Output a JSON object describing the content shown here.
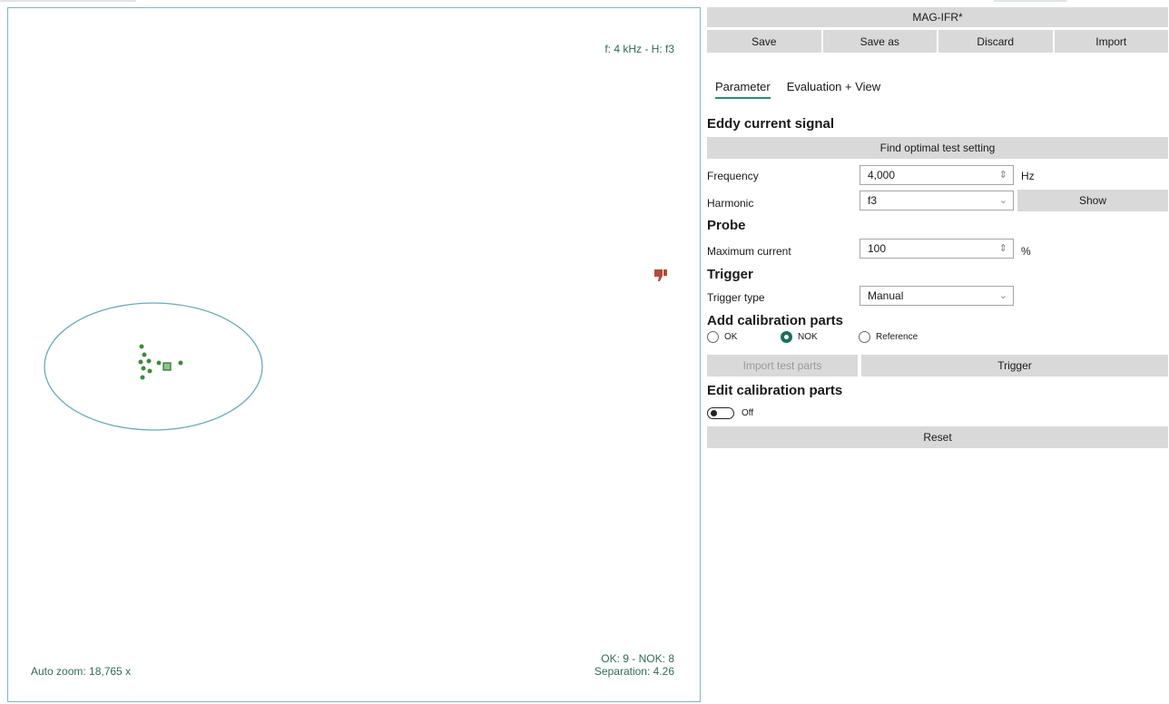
{
  "plot": {
    "freq_label": "f: 4 kHz - H: f3",
    "zoom_label": "Auto zoom: 18,765 x",
    "stats_counts": "OK: 9 - NOK: 8",
    "stats_separation": "Separation: 4.26",
    "colors": {
      "border": "#7fb8c0",
      "ellipse": "#6aaab8",
      "point": "#3d8a3a",
      "text": "#2e6b55",
      "thumb": "#b04a3a"
    }
  },
  "panel": {
    "title": "MAG-IFR*",
    "top_buttons": [
      "Save",
      "Save as",
      "Discard",
      "Import"
    ],
    "tabs": [
      "Parameter",
      "Evaluation + View"
    ],
    "eddy": {
      "heading": "Eddy current signal",
      "find_button": "Find optimal test setting",
      "frequency_label": "Frequency",
      "frequency_value": "4,000",
      "frequency_unit": "Hz",
      "harmonic_label": "Harmonic",
      "harmonic_value": "f3",
      "show_button": "Show"
    },
    "probe": {
      "heading": "Probe",
      "max_current_label": "Maximum current",
      "max_current_value": "100",
      "max_current_unit": "%"
    },
    "trigger": {
      "heading": "Trigger",
      "type_label": "Trigger type",
      "type_value": "Manual"
    },
    "calibration": {
      "heading": "Add calibration parts",
      "options": [
        "OK",
        "NOK",
        "Reference"
      ],
      "selected": "NOK",
      "import_button": "Import test parts",
      "trigger_button": "Trigger"
    },
    "edit": {
      "heading": "Edit calibration parts",
      "toggle_label": "Off",
      "reset_button": "Reset"
    },
    "colors": {
      "button_bg": "#d9d9d9",
      "accent": "#2b8a6f"
    }
  }
}
